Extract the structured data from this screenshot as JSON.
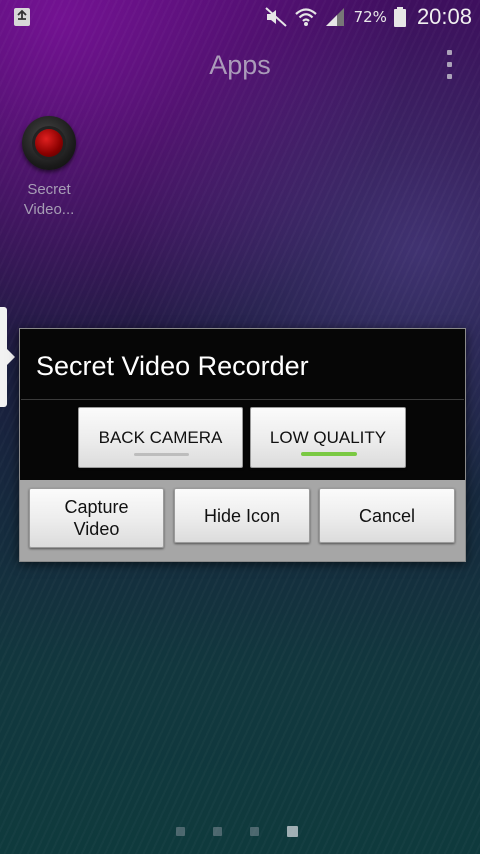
{
  "status_bar": {
    "left_icon": "recycle-notification-icon",
    "icons": [
      "mute-icon",
      "wifi-icon",
      "signal-icon",
      "battery-icon"
    ],
    "battery_percent": "72%",
    "time": "20:08"
  },
  "header": {
    "title": "Apps",
    "menu_icon": "overflow-menu-icon"
  },
  "app_shortcut": {
    "label_line1": "Secret",
    "label_line2": "Video..."
  },
  "dialog": {
    "title": "Secret Video Recorder",
    "options": {
      "camera_label": "BACK CAMERA",
      "quality_label": "LOW QUALITY"
    },
    "actions": {
      "capture_line1": "Capture",
      "capture_line2": "Video",
      "hide_label": "Hide Icon",
      "cancel_label": "Cancel"
    }
  },
  "page_indicator": {
    "count": 4,
    "active_index": 3
  },
  "colors": {
    "dialog_bg": "#060606",
    "button_bg": "#ececec",
    "action_bar": "#a6a6a6",
    "toggle_on": "#7ac943",
    "toggle_off": "#bdbdbd"
  }
}
